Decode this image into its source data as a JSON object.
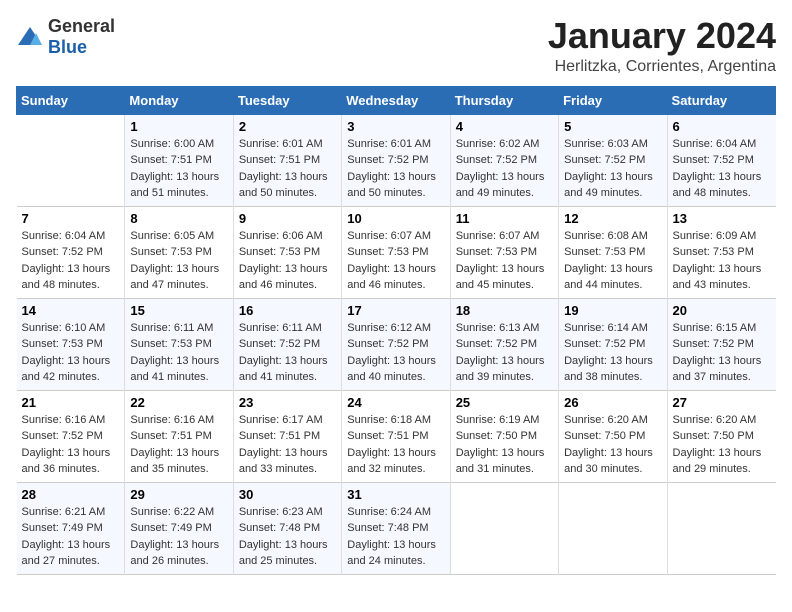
{
  "logo": {
    "general": "General",
    "blue": "Blue"
  },
  "header": {
    "month": "January 2024",
    "location": "Herlitzka, Corrientes, Argentina"
  },
  "weekdays": [
    "Sunday",
    "Monday",
    "Tuesday",
    "Wednesday",
    "Thursday",
    "Friday",
    "Saturday"
  ],
  "weeks": [
    [
      {
        "day": "",
        "sunrise": "",
        "sunset": "",
        "daylight": ""
      },
      {
        "day": "1",
        "sunrise": "Sunrise: 6:00 AM",
        "sunset": "Sunset: 7:51 PM",
        "daylight": "Daylight: 13 hours and 51 minutes."
      },
      {
        "day": "2",
        "sunrise": "Sunrise: 6:01 AM",
        "sunset": "Sunset: 7:51 PM",
        "daylight": "Daylight: 13 hours and 50 minutes."
      },
      {
        "day": "3",
        "sunrise": "Sunrise: 6:01 AM",
        "sunset": "Sunset: 7:52 PM",
        "daylight": "Daylight: 13 hours and 50 minutes."
      },
      {
        "day": "4",
        "sunrise": "Sunrise: 6:02 AM",
        "sunset": "Sunset: 7:52 PM",
        "daylight": "Daylight: 13 hours and 49 minutes."
      },
      {
        "day": "5",
        "sunrise": "Sunrise: 6:03 AM",
        "sunset": "Sunset: 7:52 PM",
        "daylight": "Daylight: 13 hours and 49 minutes."
      },
      {
        "day": "6",
        "sunrise": "Sunrise: 6:04 AM",
        "sunset": "Sunset: 7:52 PM",
        "daylight": "Daylight: 13 hours and 48 minutes."
      }
    ],
    [
      {
        "day": "7",
        "sunrise": "Sunrise: 6:04 AM",
        "sunset": "Sunset: 7:52 PM",
        "daylight": "Daylight: 13 hours and 48 minutes."
      },
      {
        "day": "8",
        "sunrise": "Sunrise: 6:05 AM",
        "sunset": "Sunset: 7:53 PM",
        "daylight": "Daylight: 13 hours and 47 minutes."
      },
      {
        "day": "9",
        "sunrise": "Sunrise: 6:06 AM",
        "sunset": "Sunset: 7:53 PM",
        "daylight": "Daylight: 13 hours and 46 minutes."
      },
      {
        "day": "10",
        "sunrise": "Sunrise: 6:07 AM",
        "sunset": "Sunset: 7:53 PM",
        "daylight": "Daylight: 13 hours and 46 minutes."
      },
      {
        "day": "11",
        "sunrise": "Sunrise: 6:07 AM",
        "sunset": "Sunset: 7:53 PM",
        "daylight": "Daylight: 13 hours and 45 minutes."
      },
      {
        "day": "12",
        "sunrise": "Sunrise: 6:08 AM",
        "sunset": "Sunset: 7:53 PM",
        "daylight": "Daylight: 13 hours and 44 minutes."
      },
      {
        "day": "13",
        "sunrise": "Sunrise: 6:09 AM",
        "sunset": "Sunset: 7:53 PM",
        "daylight": "Daylight: 13 hours and 43 minutes."
      }
    ],
    [
      {
        "day": "14",
        "sunrise": "Sunrise: 6:10 AM",
        "sunset": "Sunset: 7:53 PM",
        "daylight": "Daylight: 13 hours and 42 minutes."
      },
      {
        "day": "15",
        "sunrise": "Sunrise: 6:11 AM",
        "sunset": "Sunset: 7:53 PM",
        "daylight": "Daylight: 13 hours and 41 minutes."
      },
      {
        "day": "16",
        "sunrise": "Sunrise: 6:11 AM",
        "sunset": "Sunset: 7:52 PM",
        "daylight": "Daylight: 13 hours and 41 minutes."
      },
      {
        "day": "17",
        "sunrise": "Sunrise: 6:12 AM",
        "sunset": "Sunset: 7:52 PM",
        "daylight": "Daylight: 13 hours and 40 minutes."
      },
      {
        "day": "18",
        "sunrise": "Sunrise: 6:13 AM",
        "sunset": "Sunset: 7:52 PM",
        "daylight": "Daylight: 13 hours and 39 minutes."
      },
      {
        "day": "19",
        "sunrise": "Sunrise: 6:14 AM",
        "sunset": "Sunset: 7:52 PM",
        "daylight": "Daylight: 13 hours and 38 minutes."
      },
      {
        "day": "20",
        "sunrise": "Sunrise: 6:15 AM",
        "sunset": "Sunset: 7:52 PM",
        "daylight": "Daylight: 13 hours and 37 minutes."
      }
    ],
    [
      {
        "day": "21",
        "sunrise": "Sunrise: 6:16 AM",
        "sunset": "Sunset: 7:52 PM",
        "daylight": "Daylight: 13 hours and 36 minutes."
      },
      {
        "day": "22",
        "sunrise": "Sunrise: 6:16 AM",
        "sunset": "Sunset: 7:51 PM",
        "daylight": "Daylight: 13 hours and 35 minutes."
      },
      {
        "day": "23",
        "sunrise": "Sunrise: 6:17 AM",
        "sunset": "Sunset: 7:51 PM",
        "daylight": "Daylight: 13 hours and 33 minutes."
      },
      {
        "day": "24",
        "sunrise": "Sunrise: 6:18 AM",
        "sunset": "Sunset: 7:51 PM",
        "daylight": "Daylight: 13 hours and 32 minutes."
      },
      {
        "day": "25",
        "sunrise": "Sunrise: 6:19 AM",
        "sunset": "Sunset: 7:50 PM",
        "daylight": "Daylight: 13 hours and 31 minutes."
      },
      {
        "day": "26",
        "sunrise": "Sunrise: 6:20 AM",
        "sunset": "Sunset: 7:50 PM",
        "daylight": "Daylight: 13 hours and 30 minutes."
      },
      {
        "day": "27",
        "sunrise": "Sunrise: 6:20 AM",
        "sunset": "Sunset: 7:50 PM",
        "daylight": "Daylight: 13 hours and 29 minutes."
      }
    ],
    [
      {
        "day": "28",
        "sunrise": "Sunrise: 6:21 AM",
        "sunset": "Sunset: 7:49 PM",
        "daylight": "Daylight: 13 hours and 27 minutes."
      },
      {
        "day": "29",
        "sunrise": "Sunrise: 6:22 AM",
        "sunset": "Sunset: 7:49 PM",
        "daylight": "Daylight: 13 hours and 26 minutes."
      },
      {
        "day": "30",
        "sunrise": "Sunrise: 6:23 AM",
        "sunset": "Sunset: 7:48 PM",
        "daylight": "Daylight: 13 hours and 25 minutes."
      },
      {
        "day": "31",
        "sunrise": "Sunrise: 6:24 AM",
        "sunset": "Sunset: 7:48 PM",
        "daylight": "Daylight: 13 hours and 24 minutes."
      },
      {
        "day": "",
        "sunrise": "",
        "sunset": "",
        "daylight": ""
      },
      {
        "day": "",
        "sunrise": "",
        "sunset": "",
        "daylight": ""
      },
      {
        "day": "",
        "sunrise": "",
        "sunset": "",
        "daylight": ""
      }
    ]
  ]
}
